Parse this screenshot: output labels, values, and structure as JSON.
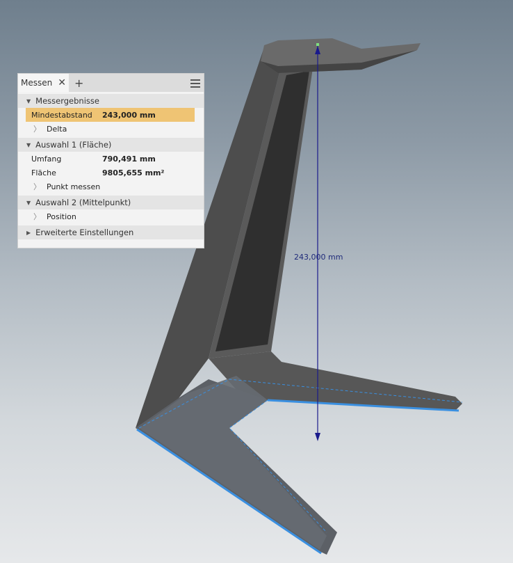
{
  "panel": {
    "tab_label": "Messen",
    "close_icon": "close-icon",
    "add_icon": "plus-icon",
    "menu_icon": "hamburger-icon",
    "sections": {
      "results": {
        "title": "Messergebnisse",
        "min_distance_label": "Mindestabstand",
        "min_distance_value": "243,000 mm",
        "delta_label": "Delta"
      },
      "selection1": {
        "title": "Auswahl 1 (Fläche)",
        "perimeter_label": "Umfang",
        "perimeter_value": "790,491 mm",
        "area_label": "Fläche",
        "area_value": "9805,655 mm²",
        "measure_point_label": "Punkt messen"
      },
      "selection2": {
        "title": "Auswahl 2 (Mittelpunkt)",
        "position_label": "Position"
      },
      "advanced": {
        "title": "Erweiterte Einstellungen"
      }
    }
  },
  "viewport": {
    "dimension_label": "243,000 mm",
    "dimension_color": "#1a1a8c",
    "highlight_color": "#3a8fe0"
  }
}
